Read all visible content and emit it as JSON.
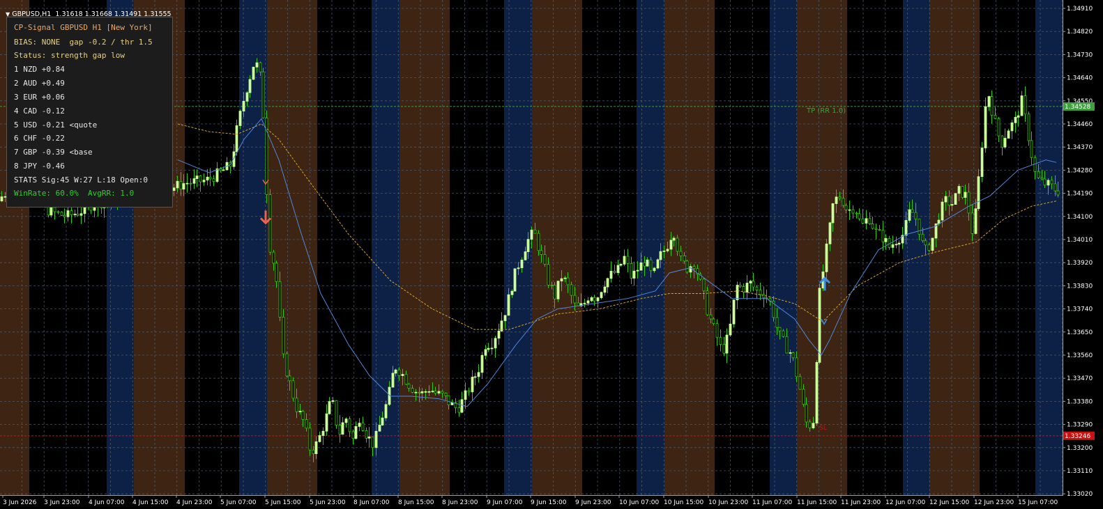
{
  "window": {
    "symbol": "GBPUSD,H1",
    "ohlc": "1.31618 1.31668 1.31491 1.31555"
  },
  "panel": {
    "title": "CP-Signal GBPUSD H1 [New York]",
    "bias": "BIAS: NONE  gap -0.2 / thr 1.5",
    "status": "Status: strength gap low",
    "ranks": [
      "1 NZD +0.84",
      "2 AUD +0.49",
      "3 EUR +0.06",
      "4 CAD -0.12",
      "5 USD -0.21 <quote",
      "6 CHF -0.22",
      "7 GBP -0.39 <base",
      "8 JPY -0.46"
    ],
    "stats": "STATS Sig:45 W:27 L:18 Open:0",
    "winrate": "WinRate: 60.0%  AvgRR: 1.0"
  },
  "markers": {
    "tp_label": "TP (RR 1.0)",
    "sl_label": "SL",
    "tp_price": "1.34528",
    "sl_price": "1.33246"
  },
  "colors": {
    "background": "#000000",
    "session_new_york": "#3e2412",
    "session_tokyo": "#0d2147",
    "bull_candle": "#ccff99",
    "wick": "#33cc00",
    "bear_candle": "#000000",
    "ma_fast": "#4f86d8",
    "ma_slow": "#d4a62b",
    "tp_line": "#3fa03f",
    "sl_line": "#cc1111",
    "sell_arrow": "#e8644b",
    "buy_arrow": "#3c8fe6",
    "grid": "#556070",
    "panel_title": "#e8a866",
    "panel_status": "#e8d080",
    "winrate_text": "#33cc33"
  },
  "chart_data": {
    "type": "candlestick",
    "symbol": "GBPUSD",
    "timeframe": "H1",
    "y_axis_labels": [
      "1.34910",
      "1.34820",
      "1.34730",
      "1.34640",
      "1.34550",
      "1.34460",
      "1.34370",
      "1.34280",
      "1.34190",
      "1.34100",
      "1.34010",
      "1.33920",
      "1.33830",
      "1.33740",
      "1.33650",
      "1.33560",
      "1.33470",
      "1.33380",
      "1.33290",
      "1.33200",
      "1.33110",
      "1.33020"
    ],
    "x_axis_labels": [
      "3 Jun 2026",
      "3 Jun 23:00",
      "4 Jun 07:00",
      "4 Jun 15:00",
      "4 Jun 23:00",
      "5 Jun 07:00",
      "5 Jun 15:00",
      "5 Jun 23:00",
      "8 Jun 07:00",
      "8 Jun 15:00",
      "8 Jun 23:00",
      "9 Jun 07:00",
      "9 Jun 15:00",
      "9 Jun 23:00",
      "10 Jun 07:00",
      "10 Jun 15:00",
      "10 Jun 23:00",
      "11 Jun 07:00",
      "11 Jun 15:00",
      "11 Jun 23:00",
      "12 Jun 07:00",
      "12 Jun 15:00",
      "12 Jun 23:00",
      "15 Jun 07:00"
    ],
    "ylim": [
      1.3296,
      1.3496
    ],
    "price_path": [
      [
        0,
        1.3416
      ],
      [
        16,
        1.342
      ],
      [
        20,
        1.3423
      ],
      [
        24,
        1.3448
      ],
      [
        36,
        1.3455
      ],
      [
        45,
        1.3443
      ],
      [
        58,
        1.3416
      ],
      [
        75,
        1.3412
      ],
      [
        100,
        1.341
      ],
      [
        120,
        1.3412
      ],
      [
        138,
        1.3415
      ],
      [
        250,
        1.3421
      ],
      [
        270,
        1.3423
      ],
      [
        300,
        1.3424
      ],
      [
        320,
        1.3427
      ],
      [
        335,
        1.343
      ],
      [
        345,
        1.3445
      ],
      [
        355,
        1.3457
      ],
      [
        370,
        1.3471
      ],
      [
        380,
        1.3462
      ],
      [
        390,
        1.34
      ],
      [
        400,
        1.3388
      ],
      [
        410,
        1.3355
      ],
      [
        420,
        1.3345
      ],
      [
        430,
        1.3335
      ],
      [
        440,
        1.333
      ],
      [
        450,
        1.3318
      ],
      [
        460,
        1.3322
      ],
      [
        470,
        1.333
      ],
      [
        480,
        1.3339
      ],
      [
        490,
        1.3325
      ],
      [
        500,
        1.3332
      ],
      [
        510,
        1.3323
      ],
      [
        520,
        1.3332
      ],
      [
        530,
        1.3325
      ],
      [
        540,
        1.3321
      ],
      [
        550,
        1.333
      ],
      [
        560,
        1.3338
      ],
      [
        570,
        1.3352
      ],
      [
        580,
        1.3349
      ],
      [
        590,
        1.3345
      ],
      [
        600,
        1.3342
      ],
      [
        610,
        1.3341
      ],
      [
        620,
        1.3343
      ],
      [
        630,
        1.3341
      ],
      [
        640,
        1.334
      ],
      [
        650,
        1.3337
      ],
      [
        660,
        1.3335
      ],
      [
        670,
        1.3339
      ],
      [
        680,
        1.3345
      ],
      [
        690,
        1.335
      ],
      [
        700,
        1.336
      ],
      [
        710,
        1.3361
      ],
      [
        720,
        1.3367
      ],
      [
        730,
        1.3374
      ],
      [
        740,
        1.3385
      ],
      [
        750,
        1.3393
      ],
      [
        760,
        1.34
      ],
      [
        770,
        1.3404
      ],
      [
        780,
        1.3395
      ],
      [
        790,
        1.3385
      ],
      [
        800,
        1.3379
      ],
      [
        810,
        1.3387
      ],
      [
        820,
        1.3382
      ],
      [
        830,
        1.3374
      ],
      [
        840,
        1.3375
      ],
      [
        850,
        1.338
      ],
      [
        860,
        1.3378
      ],
      [
        870,
        1.3384
      ],
      [
        880,
        1.3387
      ],
      [
        890,
        1.3389
      ],
      [
        900,
        1.3394
      ],
      [
        910,
        1.3386
      ],
      [
        920,
        1.339
      ],
      [
        930,
        1.3393
      ],
      [
        940,
        1.3386
      ],
      [
        950,
        1.3394
      ],
      [
        960,
        1.3398
      ],
      [
        970,
        1.3405
      ],
      [
        980,
        1.3393
      ],
      [
        990,
        1.339
      ],
      [
        1000,
        1.3392
      ],
      [
        1010,
        1.3383
      ],
      [
        1020,
        1.3372
      ],
      [
        1030,
        1.3365
      ],
      [
        1040,
        1.3357
      ],
      [
        1050,
        1.3364
      ],
      [
        1060,
        1.3383
      ],
      [
        1070,
        1.3382
      ],
      [
        1080,
        1.3384
      ],
      [
        1090,
        1.3381
      ],
      [
        1100,
        1.338
      ],
      [
        1110,
        1.3376
      ],
      [
        1120,
        1.3365
      ],
      [
        1130,
        1.336
      ],
      [
        1140,
        1.3356
      ],
      [
        1150,
        1.3345
      ],
      [
        1160,
        1.333
      ],
      [
        1170,
        1.3328
      ],
      [
        1180,
        1.338
      ],
      [
        1190,
        1.3398
      ],
      [
        1200,
        1.3416
      ],
      [
        1210,
        1.3418
      ],
      [
        1220,
        1.3412
      ],
      [
        1230,
        1.3414
      ],
      [
        1240,
        1.3406
      ],
      [
        1250,
        1.341
      ],
      [
        1260,
        1.3404
      ],
      [
        1270,
        1.3402
      ],
      [
        1280,
        1.3398
      ],
      [
        1290,
        1.3401
      ],
      [
        1300,
        1.3403
      ],
      [
        1310,
        1.3413
      ],
      [
        1320,
        1.3408
      ],
      [
        1330,
        1.3396
      ],
      [
        1340,
        1.34
      ],
      [
        1350,
        1.341
      ],
      [
        1360,
        1.3416
      ],
      [
        1370,
        1.3415
      ],
      [
        1380,
        1.342
      ],
      [
        1390,
        1.3418
      ],
      [
        1400,
        1.3402
      ],
      [
        1410,
        1.343
      ],
      [
        1420,
        1.346
      ],
      [
        1430,
        1.3448
      ],
      [
        1440,
        1.3438
      ],
      [
        1450,
        1.3444
      ],
      [
        1460,
        1.3447
      ],
      [
        1470,
        1.3455
      ],
      [
        1480,
        1.344
      ],
      [
        1490,
        1.3425
      ],
      [
        1500,
        1.3423
      ],
      [
        1510,
        1.3422
      ],
      [
        1520,
        1.342
      ]
    ],
    "ma_fast_path": [
      [
        255,
        1.3432
      ],
      [
        300,
        1.3427
      ],
      [
        330,
        1.343
      ],
      [
        350,
        1.344
      ],
      [
        375,
        1.3448
      ],
      [
        400,
        1.3432
      ],
      [
        430,
        1.3405
      ],
      [
        460,
        1.338
      ],
      [
        500,
        1.336
      ],
      [
        530,
        1.3348
      ],
      [
        560,
        1.334
      ],
      [
        590,
        1.334
      ],
      [
        630,
        1.3339
      ],
      [
        670,
        1.3336
      ],
      [
        700,
        1.3345
      ],
      [
        740,
        1.336
      ],
      [
        770,
        1.337
      ],
      [
        800,
        1.3374
      ],
      [
        850,
        1.3376
      ],
      [
        900,
        1.3378
      ],
      [
        940,
        1.3381
      ],
      [
        960,
        1.3388
      ],
      [
        990,
        1.339
      ],
      [
        1020,
        1.3384
      ],
      [
        1050,
        1.3378
      ],
      [
        1100,
        1.3378
      ],
      [
        1140,
        1.337
      ],
      [
        1160,
        1.3362
      ],
      [
        1178,
        1.3356
      ],
      [
        1190,
        1.3362
      ],
      [
        1220,
        1.338
      ],
      [
        1260,
        1.3397
      ],
      [
        1300,
        1.3403
      ],
      [
        1340,
        1.3406
      ],
      [
        1390,
        1.3414
      ],
      [
        1420,
        1.3418
      ],
      [
        1460,
        1.3428
      ],
      [
        1500,
        1.3432
      ],
      [
        1515,
        1.3431
      ]
    ],
    "ma_slow_path": [
      [
        255,
        1.3446
      ],
      [
        300,
        1.3443
      ],
      [
        340,
        1.3442
      ],
      [
        375,
        1.3446
      ],
      [
        400,
        1.344
      ],
      [
        440,
        1.3425
      ],
      [
        500,
        1.3403
      ],
      [
        560,
        1.3385
      ],
      [
        620,
        1.3374
      ],
      [
        680,
        1.3366
      ],
      [
        730,
        1.3366
      ],
      [
        800,
        1.3372
      ],
      [
        860,
        1.3374
      ],
      [
        920,
        1.3378
      ],
      [
        960,
        1.338
      ],
      [
        1010,
        1.338
      ],
      [
        1060,
        1.3381
      ],
      [
        1100,
        1.3379
      ],
      [
        1140,
        1.3376
      ],
      [
        1180,
        1.3369
      ],
      [
        1230,
        1.3383
      ],
      [
        1290,
        1.3392
      ],
      [
        1340,
        1.3396
      ],
      [
        1400,
        1.34
      ],
      [
        1440,
        1.3409
      ],
      [
        1480,
        1.3414
      ],
      [
        1515,
        1.3416
      ]
    ],
    "signals": [
      {
        "kind": "sell",
        "bar_x": 381,
        "price": 1.34215
      },
      {
        "kind": "buy",
        "bar_x": 1183,
        "price": 1.3386
      }
    ],
    "legend": "none",
    "grid": true
  }
}
